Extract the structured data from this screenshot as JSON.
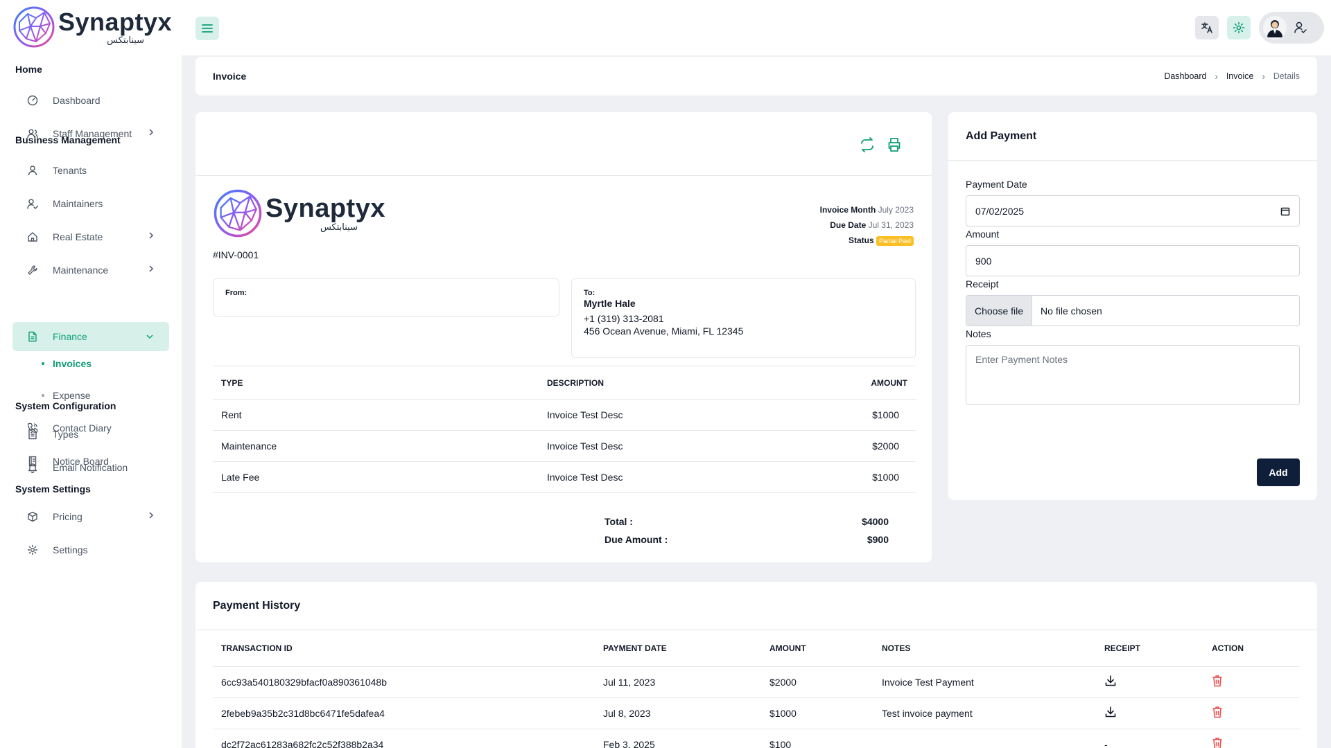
{
  "brand": {
    "name": "Synaptyx",
    "name_ar": "سينابتكس"
  },
  "colors": {
    "accent": "#0f9d77",
    "accent_soft": "#d7f1ea",
    "primary_button": "#0f1f3a",
    "status_partial": "#fbbf24",
    "delete": "#ef4444"
  },
  "header": {
    "menu_icon": "hamburger-icon",
    "translate_icon": "translate-icon",
    "settings_icon": "gear-icon",
    "profile_icon": "user-check-icon"
  },
  "sidebar": {
    "sections": [
      {
        "title": "Home"
      },
      {
        "title": "Business Management"
      },
      {
        "title": "System Configuration"
      },
      {
        "title": "System Settings"
      }
    ],
    "items": {
      "dashboard": "Dashboard",
      "staff": "Staff Management",
      "tenants": "Tenants",
      "maintainers": "Maintainers",
      "real_estate": "Real Estate",
      "maintenance": "Maintenance",
      "finance": "Finance",
      "invoices": "Invoices",
      "expense": "Expense",
      "contact_diary": "Contact Diary",
      "notice_board": "Notice Board",
      "types": "Types",
      "email_notification": "Email Notification",
      "pricing": "Pricing",
      "settings": "Settings"
    }
  },
  "breadcrumb": {
    "title": "Invoice",
    "items": [
      "Dashboard",
      "Invoice",
      "Details"
    ]
  },
  "invoice": {
    "number": "#INV-0001",
    "month_label": "Invoice Month",
    "month": "July 2023",
    "due_label": "Due Date",
    "due": "Jul 31, 2023",
    "status_label": "Status",
    "status": "Partial Paid",
    "from_label": "From:",
    "to_label": "To:",
    "to": {
      "name": "Myrtle Hale",
      "phone": "+1 (319) 313-2081",
      "address": "456 Ocean Avenue, Miami, FL 12345"
    },
    "columns": [
      "TYPE",
      "DESCRIPTION",
      "AMOUNT"
    ],
    "items": [
      {
        "type": "Rent",
        "description": "Invoice Test Desc",
        "amount": "$1000"
      },
      {
        "type": "Maintenance",
        "description": "Invoice Test Desc",
        "amount": "$2000"
      },
      {
        "type": "Late Fee",
        "description": "Invoice Test Desc",
        "amount": "$1000"
      }
    ],
    "total_label": "Total :",
    "total": "$4000",
    "due_amount_label": "Due Amount :",
    "due_amount": "$900"
  },
  "payment_form": {
    "title": "Add Payment",
    "date_label": "Payment Date",
    "date_value": "07/02/2025",
    "amount_label": "Amount",
    "amount_value": "900",
    "receipt_label": "Receipt",
    "file_button": "Choose file",
    "file_status": "No file chosen",
    "notes_label": "Notes",
    "notes_placeholder": "Enter Payment Notes",
    "submit": "Add"
  },
  "history": {
    "title": "Payment History",
    "columns": [
      "TRANSACTION ID",
      "PAYMENT DATE",
      "AMOUNT",
      "NOTES",
      "RECEIPT",
      "ACTION"
    ],
    "rows": [
      {
        "id": "6cc93a540180329bfacf0a890361048b",
        "date": "Jul 11, 2023",
        "amount": "$2000",
        "notes": "Invoice Test Payment",
        "receipt": "download-icon"
      },
      {
        "id": "2febeb9a35b2c31d8bc6471fe5dafea4",
        "date": "Jul 8, 2023",
        "amount": "$1000",
        "notes": "Test invoice payment",
        "receipt": "download-icon"
      },
      {
        "id": "dc2f72ac61283a682fc2c52f388b2a34",
        "date": "Feb 3, 2025",
        "amount": "$100",
        "notes": "",
        "receipt": "-"
      }
    ]
  }
}
